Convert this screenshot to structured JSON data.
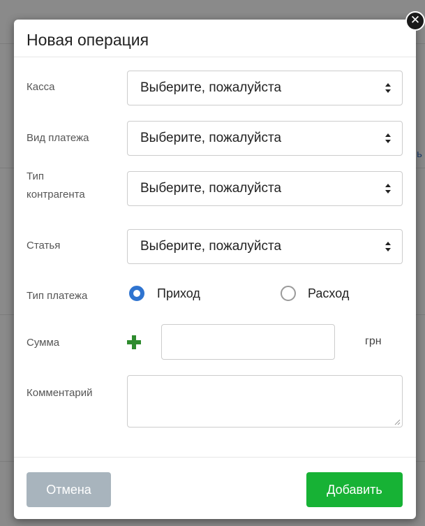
{
  "background": {
    "fragment_text": "ь"
  },
  "modal": {
    "title": "Новая операция",
    "close_icon": "close-icon",
    "fields": {
      "cash": {
        "label": "Касса",
        "value": "Выберите, пожалуйста"
      },
      "payment_kind": {
        "label": "Вид платежа",
        "value": "Выберите, пожалуйста"
      },
      "counterparty_type": {
        "label_line1": "Тип",
        "label_line2": "контрагента",
        "value": "Выберите, пожалуйста"
      },
      "article": {
        "label": "Статья",
        "value": "Выберите, пожалуйста"
      },
      "payment_type": {
        "label": "Тип платежа",
        "options": [
          {
            "label": "Приход",
            "checked": true
          },
          {
            "label": "Расход",
            "checked": false
          }
        ]
      },
      "amount": {
        "label": "Сумма",
        "value": "",
        "currency": "грн",
        "add_icon": "plus-icon"
      },
      "comment": {
        "label": "Комментарий",
        "value": ""
      }
    },
    "footer": {
      "cancel_label": "Отмена",
      "add_label": "Добавить"
    }
  },
  "colors": {
    "accent": "#2f74d0",
    "success": "#17b235",
    "muted_button": "#a8b4bd",
    "plus_icon": "#2e8b2e"
  }
}
